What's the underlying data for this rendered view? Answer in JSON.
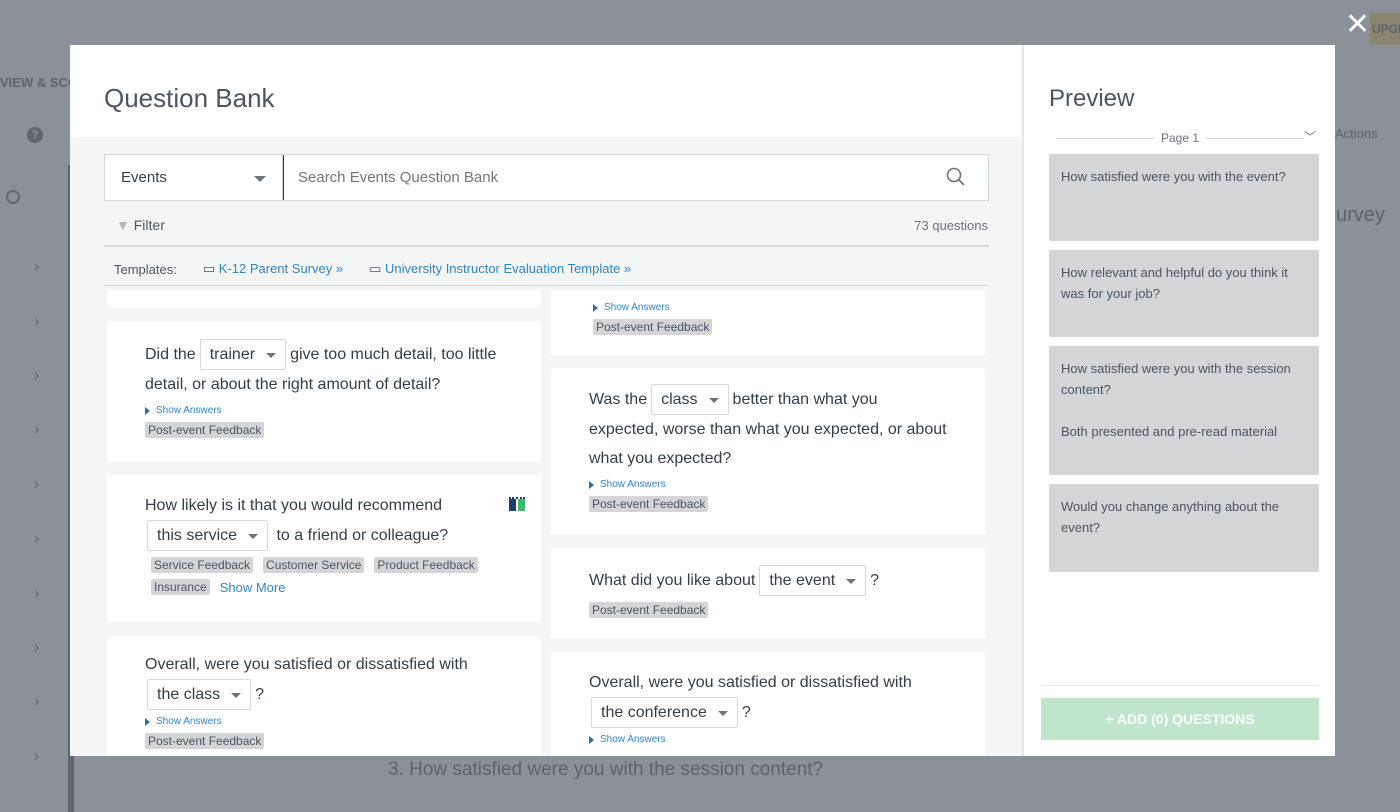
{
  "background": {
    "tab_label": "VIEW & SCO",
    "upgrade_label": "UPGR",
    "actions_label": "Actions",
    "survey_fragment": "urvey",
    "question_fragment": "3. How satisfied were you with the session content?"
  },
  "modal": {
    "title": "Question Bank",
    "category": "Events",
    "search_placeholder": "Search Events Question Bank",
    "filter_label": "Filter",
    "question_count": "73 questions",
    "templates_label": "Templates:",
    "templates": [
      "K-12 Parent Survey »",
      "University Instructor Evaluation Template »"
    ],
    "show_answers": "Show Answers",
    "show_more": "Show More",
    "left_cards": [
      {
        "pre": "Did the",
        "dropdown": "trainer",
        "post": "give too much detail, too little detail, or about the right amount of detail?",
        "tags": [
          "Post-event Feedback"
        ]
      },
      {
        "pre": "How likely is it that you would recommend",
        "dropdown": "this service",
        "post": "to a friend or colleague?",
        "tags": [
          "Service Feedback",
          "Customer Service",
          "Product Feedback",
          "Insurance"
        ]
      },
      {
        "pre": "Overall, were you satisfied or dissatisfied with",
        "dropdown": "the class",
        "post": "?",
        "tags": [
          "Post-event Feedback"
        ]
      }
    ],
    "right_cards": [
      {
        "tags": [
          "Post-event Feedback"
        ]
      },
      {
        "pre": "Was the",
        "dropdown": "class",
        "post": "better than what you expected, worse than what you expected, or about what you expected?",
        "tags": [
          "Post-event Feedback"
        ]
      },
      {
        "pre": "What did you like about",
        "dropdown": "the event",
        "post": "?",
        "tags": [
          "Post-event Feedback"
        ]
      },
      {
        "pre": "Overall, were you satisfied or dissatisfied with",
        "dropdown": "the conference",
        "post": "?"
      }
    ]
  },
  "preview": {
    "title": "Preview",
    "page_label": "Page 1",
    "questions": [
      "How satisfied were you with the event?",
      "How relevant and helpful do you think it was for your job?",
      "How satisfied were you with the session content?",
      "Both presented and pre-read material",
      "Would you change anything about the event?"
    ],
    "add_button": "+ ADD (0) QUESTIONS",
    "add_color": "#bfe6cb"
  }
}
